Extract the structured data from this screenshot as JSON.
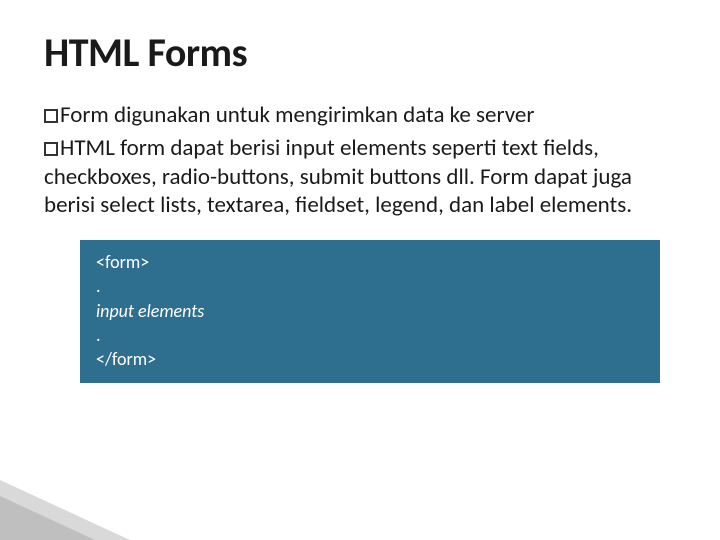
{
  "title": "HTML Forms",
  "bullets": [
    {
      "marker": "□",
      "prefix": "Form",
      "text": " digunakan untuk mengirimkan data ke server"
    },
    {
      "marker": "□",
      "prefix": "HTML",
      "text": " form dapat berisi input elements seperti text fields, checkboxes, radio-buttons, submit buttons dll. Form dapat juga berisi select lists, textarea, fieldset, legend, dan label elements."
    }
  ],
  "code": {
    "line1": "<form>",
    "line2": ".",
    "line3": "input elements",
    "line4": ".",
    "line5": "</form>"
  }
}
